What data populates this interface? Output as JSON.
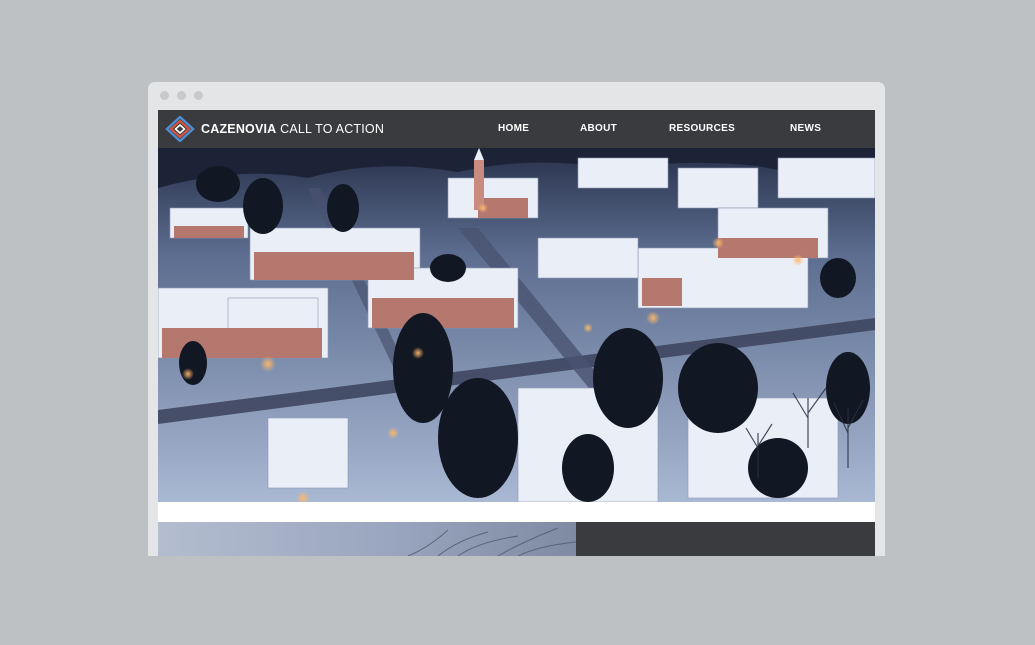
{
  "site": {
    "brand": "CAZENOVIA",
    "tagline": " CALL TO ACTION"
  },
  "nav": {
    "home": "HOME",
    "about": "ABOUT",
    "resources": "RESOURCES",
    "news": "NEWS"
  },
  "colors": {
    "background": "#bdc1c4",
    "navbar": "#3a3b3f",
    "logo_blue": "#4a8fd6",
    "logo_red": "#d9543f"
  },
  "hero": {
    "icon": "snowy-town-aerial-photo"
  }
}
